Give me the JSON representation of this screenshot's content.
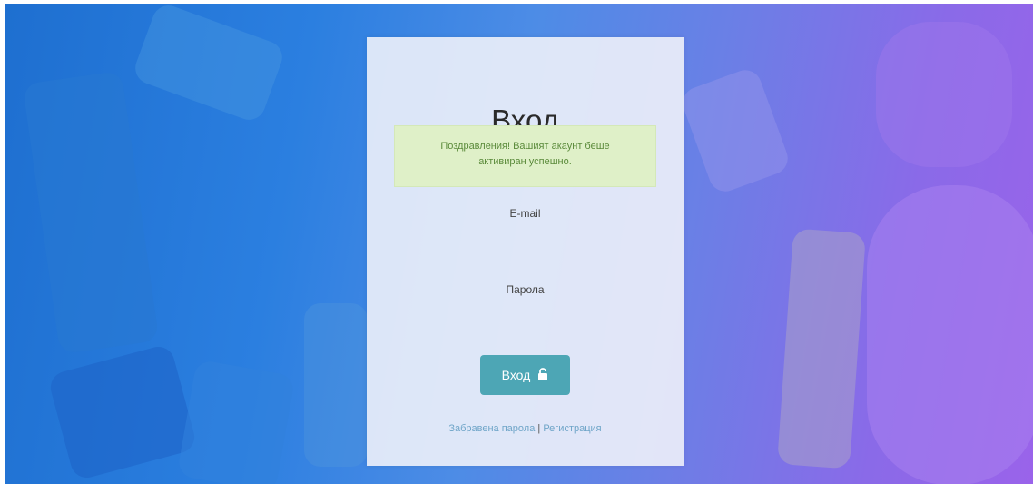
{
  "login": {
    "title": "Вход",
    "alert_text": "Поздравления! Вашият акаунт беше активиран успешно.",
    "email_label": "E-mail",
    "email_value": "",
    "password_label": "Парола",
    "password_value": "",
    "submit_label": "Вход",
    "forgot_link": "Забравена парола",
    "separator": "|",
    "register_link": "Регистрация"
  },
  "colors": {
    "button": "#4da6b5",
    "alert_bg": "#dff0c8",
    "alert_text": "#5a8a3a",
    "link": "#6fa5c8"
  },
  "icons": {
    "submit_icon": "unlock-icon"
  }
}
